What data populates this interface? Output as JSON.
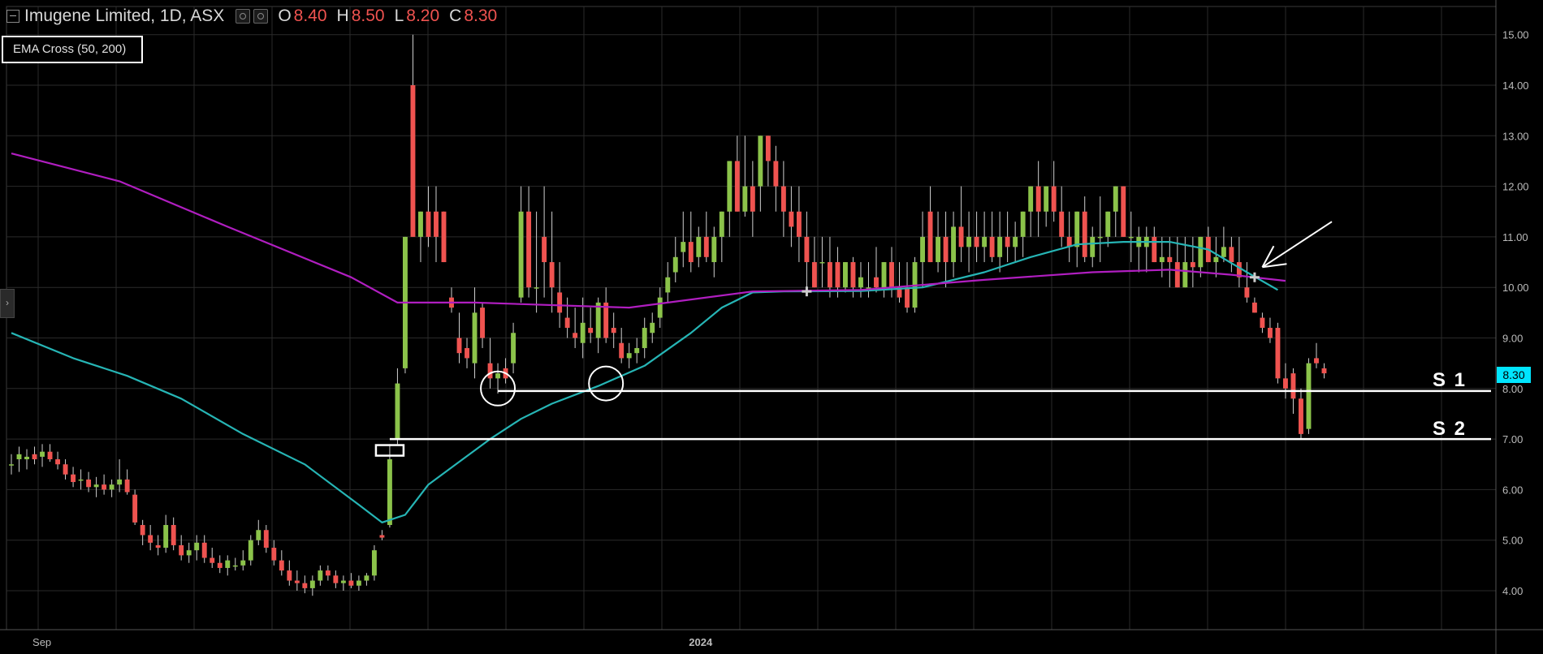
{
  "header": {
    "title": "Imugene Limited, 1D, ASX",
    "ohlc": [
      {
        "key": "O",
        "value": "8.40"
      },
      {
        "key": "H",
        "value": "8.50"
      },
      {
        "key": "L",
        "value": "8.20"
      },
      {
        "key": "C",
        "value": "8.30"
      }
    ]
  },
  "indicator_label": "EMA Cross (50, 200)",
  "last_price_tag": "8.30",
  "support_labels": [
    "S 1",
    "S 2"
  ],
  "colors": {
    "up": "#8bc34a",
    "down": "#ef5350",
    "ema_fast": "#26b5b5",
    "ema_slow": "#b01ec0",
    "grid": "#2a2a2a",
    "price_tag": "#00e5ff"
  },
  "chart_data": {
    "type": "candlestick",
    "y_axis": {
      "min": 3.7,
      "max": 15.3,
      "ticks": [
        "4.00",
        "5.00",
        "6.00",
        "7.00",
        "8.00",
        "9.00",
        "10.00",
        "11.00",
        "12.00",
        "13.00",
        "14.00",
        "15.00"
      ]
    },
    "x_axis": {
      "labels": [
        {
          "label": "Sep",
          "index": 4
        },
        {
          "label": "2024",
          "index": 89
        }
      ]
    },
    "bar_count": 172,
    "candles": [
      [
        6.5,
        6.7,
        6.3,
        6.5
      ],
      [
        6.6,
        6.85,
        6.35,
        6.7
      ],
      [
        6.6,
        6.8,
        6.4,
        6.65
      ],
      [
        6.7,
        6.85,
        6.5,
        6.6
      ],
      [
        6.65,
        6.9,
        6.45,
        6.75
      ],
      [
        6.75,
        6.9,
        6.55,
        6.6
      ],
      [
        6.6,
        6.75,
        6.4,
        6.5
      ],
      [
        6.5,
        6.6,
        6.2,
        6.3
      ],
      [
        6.3,
        6.45,
        6.05,
        6.15
      ],
      [
        6.2,
        6.4,
        6.0,
        6.2
      ],
      [
        6.2,
        6.35,
        5.95,
        6.05
      ],
      [
        6.05,
        6.25,
        5.85,
        6.1
      ],
      [
        6.1,
        6.3,
        5.9,
        6.0
      ],
      [
        6.0,
        6.2,
        5.85,
        6.1
      ],
      [
        6.1,
        6.6,
        5.95,
        6.2
      ],
      [
        6.2,
        6.4,
        5.9,
        5.95
      ],
      [
        5.9,
        6.0,
        5.3,
        5.35
      ],
      [
        5.3,
        5.4,
        4.9,
        5.1
      ],
      [
        5.1,
        5.3,
        4.8,
        4.95
      ],
      [
        4.9,
        5.1,
        4.7,
        4.85
      ],
      [
        4.85,
        5.5,
        4.75,
        5.3
      ],
      [
        5.3,
        5.45,
        4.8,
        4.9
      ],
      [
        4.9,
        5.1,
        4.6,
        4.7
      ],
      [
        4.7,
        4.95,
        4.55,
        4.8
      ],
      [
        4.8,
        5.1,
        4.6,
        4.95
      ],
      [
        4.95,
        5.1,
        4.55,
        4.65
      ],
      [
        4.65,
        4.85,
        4.45,
        4.55
      ],
      [
        4.55,
        4.7,
        4.35,
        4.45
      ],
      [
        4.45,
        4.7,
        4.3,
        4.6
      ],
      [
        4.5,
        4.65,
        4.4,
        4.5
      ],
      [
        4.5,
        4.8,
        4.4,
        4.6
      ],
      [
        4.6,
        5.1,
        4.5,
        5.0
      ],
      [
        5.0,
        5.4,
        4.9,
        5.2
      ],
      [
        5.2,
        5.3,
        4.75,
        4.85
      ],
      [
        4.85,
        5.0,
        4.5,
        4.6
      ],
      [
        4.6,
        4.8,
        4.3,
        4.4
      ],
      [
        4.4,
        4.6,
        4.1,
        4.2
      ],
      [
        4.2,
        4.4,
        4.0,
        4.15
      ],
      [
        4.15,
        4.3,
        3.95,
        4.05
      ],
      [
        4.05,
        4.3,
        3.9,
        4.2
      ],
      [
        4.2,
        4.5,
        4.1,
        4.4
      ],
      [
        4.4,
        4.5,
        4.2,
        4.3
      ],
      [
        4.3,
        4.4,
        4.05,
        4.15
      ],
      [
        4.15,
        4.3,
        4.0,
        4.2
      ],
      [
        4.2,
        4.35,
        4.05,
        4.1
      ],
      [
        4.1,
        4.3,
        4.0,
        4.2
      ],
      [
        4.2,
        4.35,
        4.1,
        4.3
      ],
      [
        4.3,
        4.9,
        4.2,
        4.8
      ],
      [
        5.1,
        5.2,
        5.0,
        5.05
      ],
      [
        5.3,
        6.9,
        5.25,
        6.6
      ],
      [
        7.0,
        8.4,
        6.9,
        8.1
      ],
      [
        8.4,
        11.0,
        8.3,
        11.0
      ],
      [
        14.0,
        15.0,
        11.0,
        11.0
      ],
      [
        11.0,
        11.5,
        10.5,
        11.5
      ],
      [
        11.5,
        12.0,
        10.8,
        11.0
      ],
      [
        11.5,
        12.0,
        10.5,
        11.0
      ],
      [
        11.5,
        11.5,
        10.5,
        10.5
      ],
      [
        9.8,
        10.0,
        9.5,
        9.6
      ],
      [
        9.0,
        9.5,
        8.5,
        8.7
      ],
      [
        8.8,
        9.0,
        8.4,
        8.6
      ],
      [
        8.5,
        10.0,
        8.2,
        9.5
      ],
      [
        9.6,
        9.7,
        8.8,
        9.0
      ],
      [
        8.5,
        9.0,
        8.0,
        8.2
      ],
      [
        8.2,
        8.5,
        7.9,
        8.3
      ],
      [
        8.4,
        8.6,
        8.1,
        8.2
      ],
      [
        8.5,
        9.3,
        8.3,
        9.1
      ],
      [
        9.8,
        12.0,
        9.7,
        11.5
      ],
      [
        11.5,
        12.0,
        9.8,
        10.0
      ],
      [
        10.0,
        11.5,
        9.5,
        10.0
      ],
      [
        11.0,
        12.0,
        9.8,
        10.5
      ],
      [
        10.5,
        11.5,
        9.5,
        10.0
      ],
      [
        9.9,
        10.5,
        9.2,
        9.5
      ],
      [
        9.4,
        9.8,
        9.0,
        9.2
      ],
      [
        9.1,
        9.6,
        8.8,
        9.0
      ],
      [
        8.9,
        9.8,
        8.6,
        9.3
      ],
      [
        9.2,
        9.6,
        8.9,
        9.1
      ],
      [
        9.0,
        9.8,
        8.7,
        9.7
      ],
      [
        9.7,
        10.0,
        8.9,
        9.0
      ],
      [
        9.2,
        9.5,
        8.8,
        9.1
      ],
      [
        8.9,
        9.2,
        8.5,
        8.6
      ],
      [
        8.6,
        8.9,
        8.4,
        8.7
      ],
      [
        8.7,
        9.0,
        8.5,
        8.8
      ],
      [
        8.8,
        9.4,
        8.6,
        9.2
      ],
      [
        9.1,
        9.5,
        8.9,
        9.3
      ],
      [
        9.4,
        10.0,
        9.2,
        9.8
      ],
      [
        9.9,
        10.5,
        9.7,
        10.2
      ],
      [
        10.3,
        11.0,
        10.1,
        10.6
      ],
      [
        10.7,
        11.5,
        10.4,
        10.9
      ],
      [
        10.9,
        11.5,
        10.3,
        10.5
      ],
      [
        10.6,
        11.2,
        10.4,
        11.0
      ],
      [
        11.0,
        11.5,
        10.5,
        10.6
      ],
      [
        10.5,
        11.2,
        10.2,
        11.0
      ],
      [
        11.0,
        11.5,
        10.5,
        11.5
      ],
      [
        11.5,
        12.5,
        11.0,
        12.5
      ],
      [
        12.5,
        13.0,
        11.5,
        11.5
      ],
      [
        11.5,
        13.0,
        11.4,
        12.0
      ],
      [
        12.0,
        12.5,
        11.0,
        11.5
      ],
      [
        12.0,
        13.0,
        11.5,
        13.0
      ],
      [
        13.0,
        13.0,
        12.0,
        12.5
      ],
      [
        12.5,
        12.8,
        11.5,
        12.0
      ],
      [
        12.0,
        12.5,
        11.0,
        11.5
      ],
      [
        11.5,
        12.0,
        10.8,
        11.2
      ],
      [
        11.5,
        12.0,
        10.5,
        11.0
      ],
      [
        11.0,
        11.5,
        10.0,
        10.5
      ],
      [
        10.5,
        11.0,
        10.0,
        10.0
      ],
      [
        10.5,
        11.0,
        10.0,
        10.5
      ],
      [
        10.5,
        11.0,
        9.8,
        10.0
      ],
      [
        10.5,
        10.8,
        9.8,
        10.0
      ],
      [
        10.0,
        10.5,
        9.9,
        10.5
      ],
      [
        10.5,
        10.6,
        9.8,
        10.0
      ],
      [
        10.0,
        10.5,
        9.8,
        10.2
      ],
      [
        10.0,
        10.5,
        9.8,
        10.0
      ],
      [
        10.2,
        10.8,
        9.9,
        10.0
      ],
      [
        10.0,
        10.5,
        9.8,
        10.5
      ],
      [
        10.5,
        10.8,
        9.8,
        10.0
      ],
      [
        10.0,
        10.5,
        9.7,
        9.8
      ],
      [
        10.0,
        10.5,
        9.5,
        9.6
      ],
      [
        9.6,
        10.6,
        9.5,
        10.5
      ],
      [
        10.5,
        11.5,
        10.0,
        11.0
      ],
      [
        11.5,
        12.0,
        10.5,
        10.5
      ],
      [
        10.5,
        11.5,
        10.3,
        11.0
      ],
      [
        11.0,
        11.5,
        10.0,
        10.5
      ],
      [
        10.5,
        11.5,
        10.2,
        11.2
      ],
      [
        11.2,
        12.0,
        10.5,
        10.8
      ],
      [
        10.8,
        11.5,
        10.3,
        11.0
      ],
      [
        11.0,
        11.5,
        10.5,
        10.8
      ],
      [
        10.8,
        11.5,
        10.5,
        11.0
      ],
      [
        11.0,
        11.5,
        10.5,
        10.6
      ],
      [
        10.6,
        11.5,
        10.3,
        11.0
      ],
      [
        11.0,
        11.5,
        10.5,
        10.8
      ],
      [
        10.8,
        11.3,
        10.5,
        11.0
      ],
      [
        11.0,
        11.5,
        10.6,
        11.5
      ],
      [
        11.5,
        12.0,
        11.0,
        12.0
      ],
      [
        12.0,
        12.5,
        11.0,
        11.5
      ],
      [
        11.5,
        12.0,
        11.2,
        12.0
      ],
      [
        12.0,
        12.5,
        11.3,
        11.5
      ],
      [
        11.5,
        12.0,
        10.8,
        11.0
      ],
      [
        11.0,
        11.5,
        10.5,
        10.8
      ],
      [
        10.8,
        11.5,
        10.4,
        11.5
      ],
      [
        11.5,
        11.8,
        10.5,
        10.6
      ],
      [
        10.6,
        11.2,
        10.4,
        11.0
      ],
      [
        11.0,
        11.8,
        10.5,
        11.0
      ],
      [
        11.0,
        11.5,
        10.8,
        11.5
      ],
      [
        11.5,
        12.0,
        11.0,
        12.0
      ],
      [
        12.0,
        12.0,
        11.0,
        11.0
      ],
      [
        11.0,
        11.5,
        10.5,
        11.0
      ],
      [
        10.8,
        11.2,
        10.3,
        11.0
      ],
      [
        10.8,
        11.2,
        10.3,
        11.0
      ],
      [
        11.0,
        11.2,
        10.5,
        10.5
      ],
      [
        10.5,
        11.0,
        10.2,
        10.6
      ],
      [
        10.6,
        11.0,
        10.0,
        10.5
      ],
      [
        10.5,
        11.0,
        10.0,
        10.0
      ],
      [
        10.0,
        11.0,
        10.0,
        10.5
      ],
      [
        10.5,
        11.0,
        10.0,
        10.4
      ],
      [
        10.4,
        11.0,
        10.2,
        11.0
      ],
      [
        11.0,
        11.2,
        10.5,
        10.5
      ],
      [
        10.5,
        11.0,
        10.2,
        10.6
      ],
      [
        10.6,
        11.2,
        10.5,
        10.8
      ],
      [
        10.8,
        11.0,
        10.3,
        10.5
      ],
      [
        10.5,
        11.0,
        10.0,
        10.2
      ],
      [
        10.0,
        10.5,
        9.7,
        9.8
      ],
      [
        9.7,
        9.8,
        9.5,
        9.5
      ],
      [
        9.4,
        9.5,
        9.1,
        9.2
      ],
      [
        9.2,
        9.4,
        8.9,
        9.0
      ],
      [
        9.2,
        9.3,
        8.1,
        8.2
      ],
      [
        8.2,
        8.5,
        7.8,
        8.0
      ],
      [
        8.3,
        8.4,
        7.5,
        7.8
      ],
      [
        7.8,
        8.0,
        7.0,
        7.1
      ],
      [
        7.2,
        8.6,
        7.1,
        8.5
      ],
      [
        8.6,
        8.9,
        8.4,
        8.5
      ],
      [
        8.4,
        8.5,
        8.2,
        8.3
      ]
    ],
    "series": [
      {
        "name": "EMA 50",
        "type": "line",
        "color": "#26b5b5",
        "points": [
          [
            0,
            9.1
          ],
          [
            8,
            8.6
          ],
          [
            15,
            8.25
          ],
          [
            22,
            7.8
          ],
          [
            30,
            7.1
          ],
          [
            38,
            6.5
          ],
          [
            45,
            5.7
          ],
          [
            48,
            5.35
          ],
          [
            51,
            5.5
          ],
          [
            54,
            6.1
          ],
          [
            58,
            6.55
          ],
          [
            62,
            7.0
          ],
          [
            66,
            7.4
          ],
          [
            70,
            7.7
          ],
          [
            76,
            8.05
          ],
          [
            82,
            8.45
          ],
          [
            88,
            9.1
          ],
          [
            92,
            9.6
          ],
          [
            96,
            9.9
          ],
          [
            100,
            9.92
          ],
          [
            110,
            9.93
          ],
          [
            118,
            10.0
          ],
          [
            126,
            10.3
          ],
          [
            132,
            10.6
          ],
          [
            138,
            10.85
          ],
          [
            144,
            10.9
          ],
          [
            150,
            10.9
          ],
          [
            155,
            10.75
          ],
          [
            160,
            10.3
          ],
          [
            164,
            9.95
          ]
        ]
      },
      {
        "name": "EMA 200",
        "type": "line",
        "color": "#b01ec0",
        "points": [
          [
            0,
            12.65
          ],
          [
            14,
            12.1
          ],
          [
            28,
            11.2
          ],
          [
            44,
            10.2
          ],
          [
            50,
            9.7
          ],
          [
            60,
            9.7
          ],
          [
            80,
            9.6
          ],
          [
            96,
            9.92
          ],
          [
            110,
            9.95
          ],
          [
            126,
            10.15
          ],
          [
            140,
            10.3
          ],
          [
            150,
            10.35
          ],
          [
            158,
            10.25
          ],
          [
            165,
            10.13
          ]
        ]
      }
    ],
    "horizontal_lines": [
      {
        "label": "S 1",
        "value": 7.95,
        "x_start": 63
      },
      {
        "label": "S 2",
        "value": 7.0,
        "x_start": 49
      }
    ],
    "annotations": {
      "circles": [
        {
          "x": 63,
          "y": 8.0
        },
        {
          "x": 77,
          "y": 8.1
        }
      ],
      "rectangle": {
        "x": 49,
        "y": 6.8
      },
      "crosses": [
        {
          "x": 103,
          "y": 9.92
        },
        {
          "x": 161,
          "y": 10.2
        }
      ],
      "arrow": {
        "from": [
          171,
          11.3
        ],
        "to": [
          162,
          10.4
        ]
      }
    }
  }
}
